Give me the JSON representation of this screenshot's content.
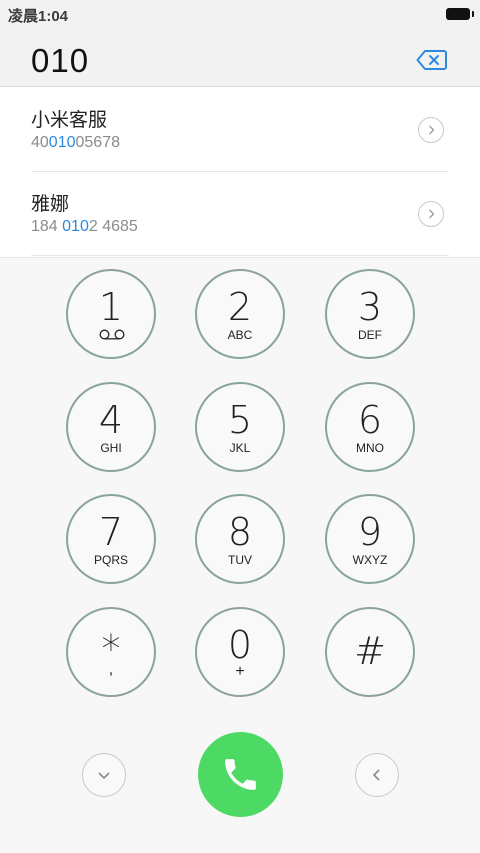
{
  "status": {
    "time": "凌晨1:04"
  },
  "dialer": {
    "dialed": "010"
  },
  "results": [
    {
      "name": "小米客服",
      "num_pre": "40",
      "num_hl": "010",
      "num_post": "05678"
    },
    {
      "name": "雅娜",
      "num_pre": "184 ",
      "num_hl": "010",
      "num_post": "2 4685"
    }
  ],
  "keys": [
    {
      "digit": "1",
      "letters": ""
    },
    {
      "digit": "2",
      "letters": "ABC"
    },
    {
      "digit": "3",
      "letters": "DEF"
    },
    {
      "digit": "4",
      "letters": "GHI"
    },
    {
      "digit": "5",
      "letters": "JKL"
    },
    {
      "digit": "6",
      "letters": "MNO"
    },
    {
      "digit": "7",
      "letters": "PQRS"
    },
    {
      "digit": "8",
      "letters": "TUV"
    },
    {
      "digit": "9",
      "letters": "WXYZ"
    },
    {
      "digit": "*",
      "letters": ","
    },
    {
      "digit": "0",
      "letters": "+"
    },
    {
      "digit": "#",
      "letters": ""
    }
  ],
  "icons": {
    "backspace": "backspace-icon",
    "voicemail": "voicemail-icon",
    "call": "phone-icon",
    "collapse": "chevron-down-icon",
    "back": "chevron-left-icon",
    "detail": "chevron-right-icon"
  },
  "colors": {
    "accent": "#2b8ae0",
    "call": "#4cd964",
    "key_border": "#8aa39c"
  }
}
